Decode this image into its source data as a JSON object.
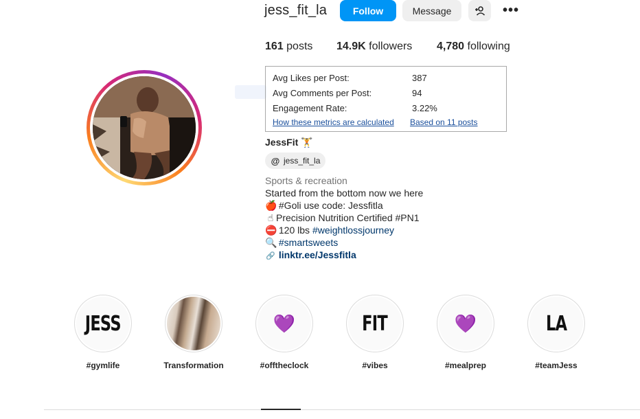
{
  "profile": {
    "username": "jess_fit_la",
    "follow_label": "Follow",
    "message_label": "Message",
    "add_user_icon": "add-user-icon",
    "more_icon": "more-icon",
    "more_glyph": "•••"
  },
  "stats": {
    "posts_count": "161",
    "posts_label": "posts",
    "followers_count": "14.9K",
    "followers_label": "followers",
    "following_count": "4,780",
    "following_label": "following"
  },
  "metrics": {
    "avg_likes_label": "Avg Likes per Post:",
    "avg_likes_value": "387",
    "avg_comments_label": "Avg Comments per Post:",
    "avg_comments_value": "94",
    "engagement_label": "Engagement Rate:",
    "engagement_value": "3.22%",
    "how_link": "How these metrics are calculated",
    "based_link": "Based on 11 posts"
  },
  "bio": {
    "full_name": "JessFit",
    "name_emoji": "🏋",
    "threads_handle": "jess_fit_la",
    "threads_glyph": "@",
    "category": "Sports & recreation",
    "line1": "Started from the bottom now we here",
    "line2_emoji": "🍎",
    "line2_text": " #Goli use code: Jessfitla",
    "line3_emoji": "☝",
    "line3_text": "Precision Nutrition Certified #PN1",
    "line4_emoji": "⛔",
    "line4_text": " 120 lbs ",
    "line4_hashtag": "#weightlossjourney",
    "line5_emoji": "🔍",
    "line5_hashtag": "#smartsweets",
    "link_glyph": "🔗",
    "link": "linktr.ee/Jessfitla"
  },
  "highlights": [
    {
      "label": "#gymlife",
      "cover_text": "JESS"
    },
    {
      "label": "Transformation",
      "cover_text": ""
    },
    {
      "label": "#offtheclock",
      "cover_glyph": "💜"
    },
    {
      "label": "#vibes",
      "cover_text": "FIT"
    },
    {
      "label": "#mealprep",
      "cover_glyph": "💜"
    },
    {
      "label": "#teamJess",
      "cover_text": "LA"
    }
  ],
  "colors": {
    "follow_button": "#0095f6",
    "secondary_button": "#efefef",
    "hashtag": "#00376b",
    "metrics_link": "#1a4f9c"
  }
}
